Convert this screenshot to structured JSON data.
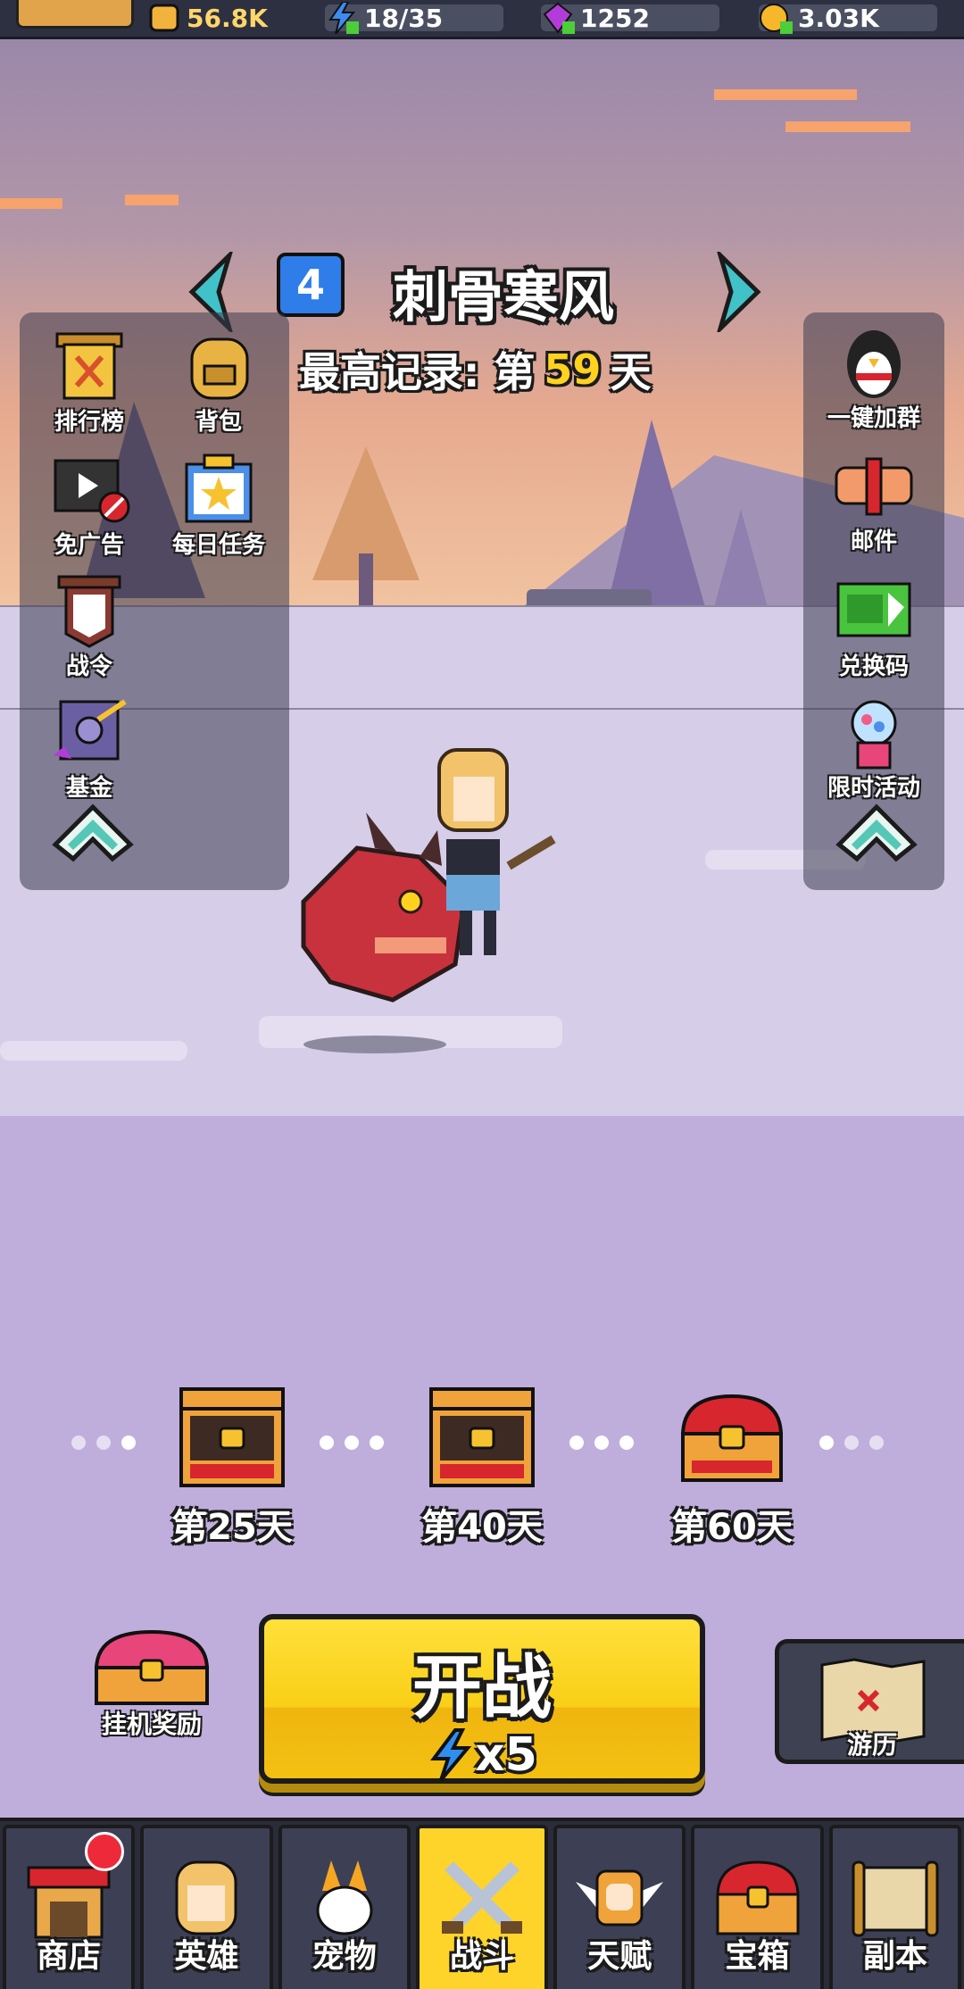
{
  "resources": [
    {
      "id": "power",
      "value": "56.8K",
      "icon": "helmet-icon"
    },
    {
      "id": "energy",
      "value": "18/35",
      "icon": "lightning-icon"
    },
    {
      "id": "gems",
      "value": "1252",
      "icon": "gem-icon"
    },
    {
      "id": "gold",
      "value": "3.03K",
      "icon": "coin-icon"
    }
  ],
  "stage": {
    "number": "4",
    "name": "刺骨寒风",
    "record_prefix": "最高记录: 第",
    "record_days": "59",
    "record_suffix": "天"
  },
  "left_menu": [
    {
      "label": "排行榜",
      "icon": "banner-icon"
    },
    {
      "label": "背包",
      "icon": "backpack-icon"
    },
    {
      "label": "免广告",
      "icon": "no-ads-icon"
    },
    {
      "label": "每日任务",
      "icon": "daily-task-icon"
    },
    {
      "label": "战令",
      "icon": "battle-pass-icon"
    },
    {
      "label": "基金",
      "icon": "fund-safe-icon"
    }
  ],
  "right_menu": [
    {
      "label": "一键加群",
      "icon": "penguin-icon"
    },
    {
      "label": "邮件",
      "icon": "mail-scroll-icon"
    },
    {
      "label": "兑换码",
      "icon": "ticket-icon"
    },
    {
      "label": "限时活动",
      "icon": "gumball-machine-icon"
    }
  ],
  "milestones": [
    {
      "label": "第25天",
      "state": "opened"
    },
    {
      "label": "第40天",
      "state": "opened"
    },
    {
      "label": "第60天",
      "state": "locked"
    }
  ],
  "actions": {
    "idle_reward": "挂机奖励",
    "battle_label": "开战",
    "battle_cost": "x5",
    "travel_label": "游历"
  },
  "nav": [
    {
      "label": "商店",
      "icon": "shop-icon",
      "badge": true
    },
    {
      "label": "英雄",
      "icon": "hero-icon"
    },
    {
      "label": "宠物",
      "icon": "pet-icon"
    },
    {
      "label": "战斗",
      "icon": "crossed-swords-icon",
      "active": true
    },
    {
      "label": "天赋",
      "icon": "talent-fist-icon"
    },
    {
      "label": "宝箱",
      "icon": "chest-icon"
    },
    {
      "label": "副本",
      "icon": "map-scroll-icon"
    }
  ],
  "colors": {
    "accent_yellow": "#ffd42a",
    "stage_blue": "#2f7de8",
    "record_highlight": "#ffd21f",
    "badge_red": "#ee2a3a"
  }
}
